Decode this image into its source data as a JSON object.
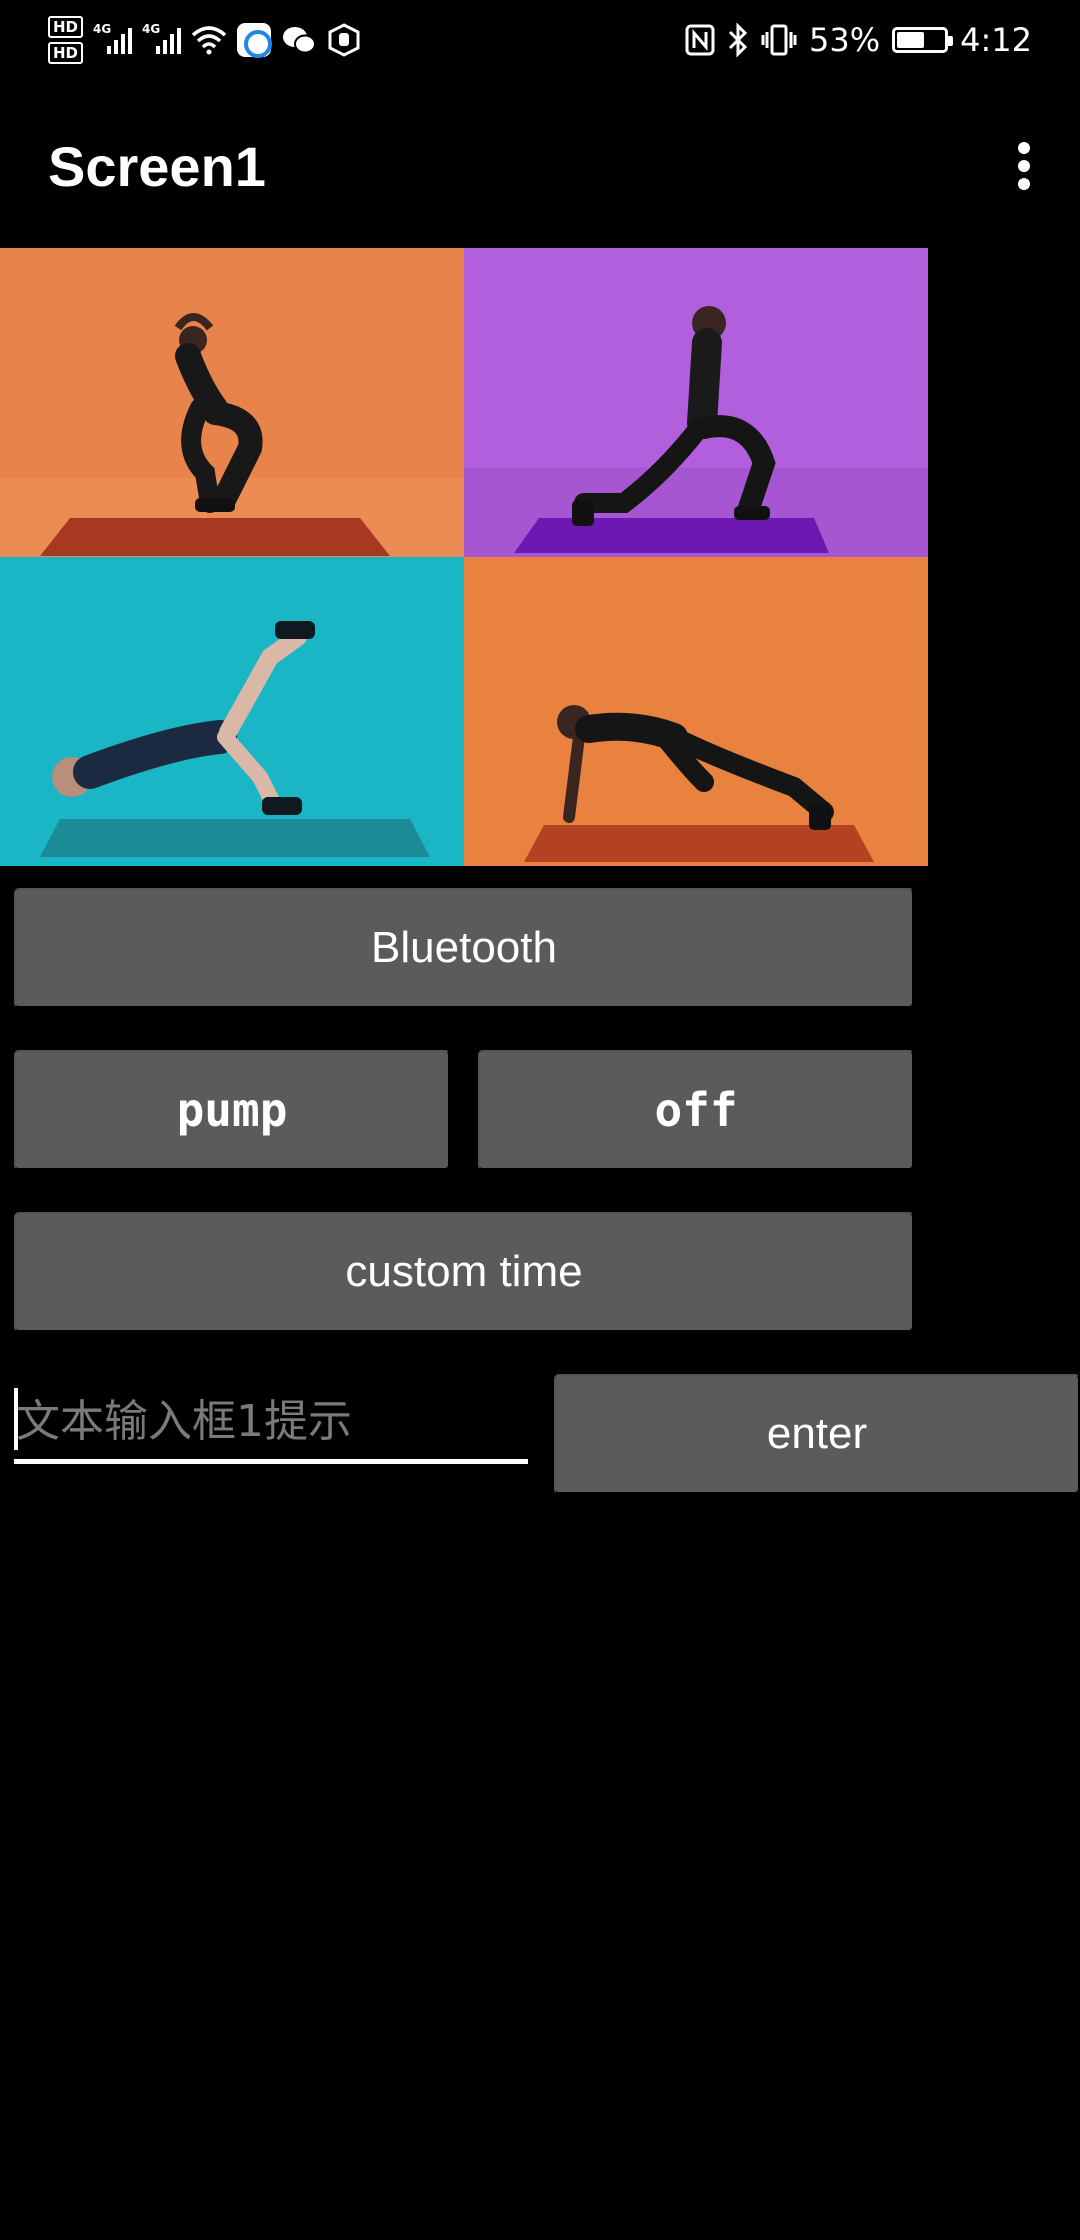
{
  "status_bar": {
    "hd1": "HD",
    "hd2": "HD",
    "net1": "4G",
    "net2": "4G",
    "battery_percent": "53%",
    "time": "4:12",
    "icons": [
      "hd-icon",
      "signal-icon",
      "signal-icon",
      "wifi-icon",
      "app-notification-icon",
      "wechat-icon",
      "hand-icon",
      "nfc-icon",
      "bluetooth-icon",
      "vibrate-icon",
      "battery-icon"
    ]
  },
  "app_bar": {
    "title": "Screen1",
    "menu_icon": "more-vert-icon"
  },
  "hero": {
    "tiles": [
      {
        "name": "squat",
        "bg": "#e8834a"
      },
      {
        "name": "lunge",
        "bg": "#a658d4"
      },
      {
        "name": "glute-bridge",
        "bg": "#1bb7c8"
      },
      {
        "name": "mountain-climber",
        "bg": "#e8823f"
      }
    ]
  },
  "buttons": {
    "bluetooth": "Bluetooth",
    "pump": "pump",
    "off": "off",
    "custom_time": "custom time",
    "enter": "enter"
  },
  "text_input": {
    "placeholder": "文本输入框1提示",
    "value": ""
  },
  "colors": {
    "background": "#000000",
    "button": "#5b5b5b",
    "text": "#ffffff"
  }
}
